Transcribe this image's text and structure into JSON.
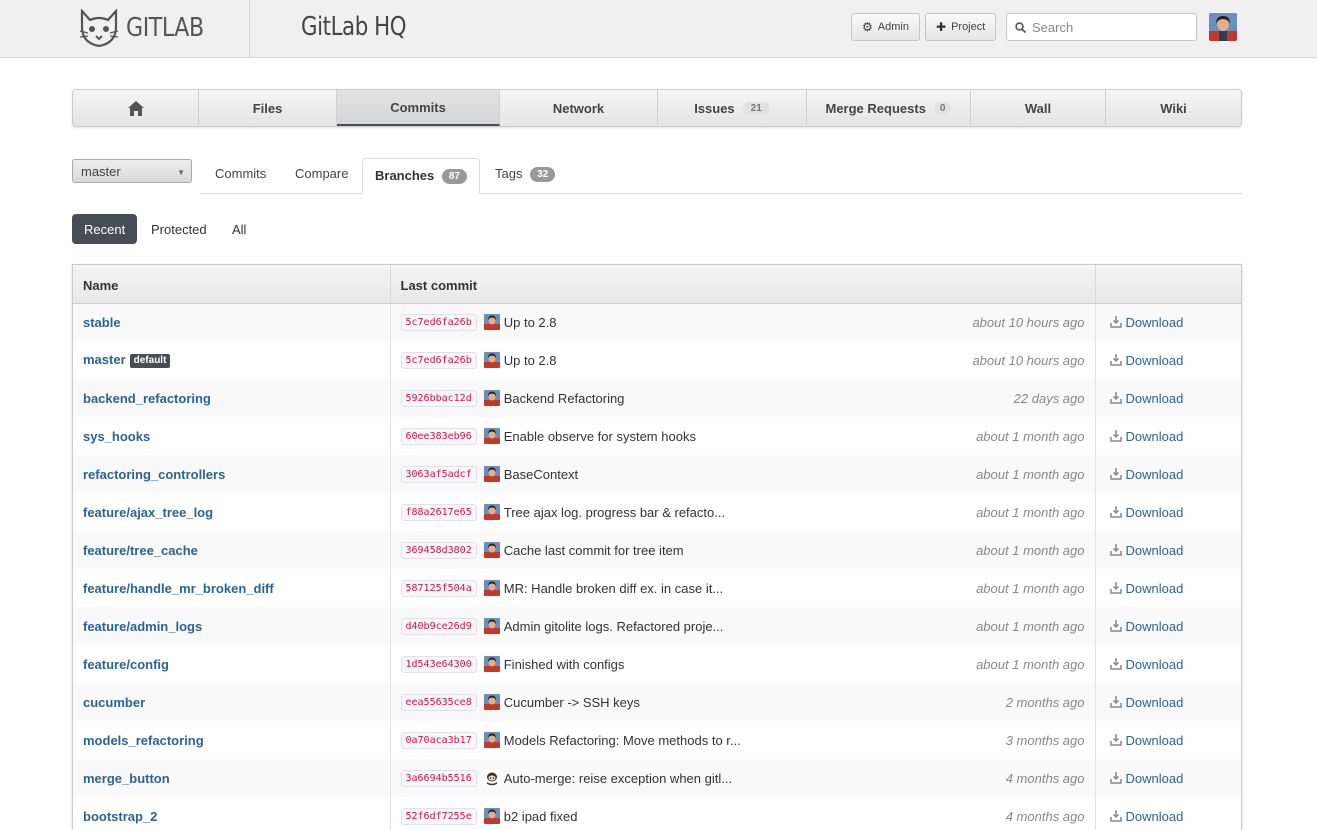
{
  "header": {
    "logo_text": "GITLAB",
    "project_title": "GitLab HQ",
    "admin_label": "Admin",
    "project_label": "Project",
    "search_placeholder": "Search"
  },
  "main_nav": {
    "files": "Files",
    "commits": "Commits",
    "network": "Network",
    "issues": "Issues",
    "issues_count": "21",
    "merge_requests": "Merge Requests",
    "merge_requests_count": "0",
    "wall": "Wall",
    "wiki": "Wiki"
  },
  "branch_select": {
    "value": "master"
  },
  "sub_tabs": {
    "commits": "Commits",
    "compare": "Compare",
    "branches": "Branches",
    "branches_count": "87",
    "tags": "Tags",
    "tags_count": "32"
  },
  "filters": {
    "recent": "Recent",
    "protected": "Protected",
    "all": "All"
  },
  "table": {
    "headers": {
      "name": "Name",
      "last_commit": "Last commit",
      "actions": ""
    },
    "default_badge": "default",
    "download_label": "Download",
    "rows": [
      {
        "name": "stable",
        "default": false,
        "sha": "5c7ed6fa26b",
        "message": "Up to 2.8",
        "time": "about 10 hours ago",
        "avatar": "photo"
      },
      {
        "name": "master",
        "default": true,
        "sha": "5c7ed6fa26b",
        "message": "Up to 2.8",
        "time": "about 10 hours ago",
        "avatar": "photo"
      },
      {
        "name": "backend_refactoring",
        "default": false,
        "sha": "5926bbac12d",
        "message": "Backend Refactoring",
        "time": "22 days ago",
        "avatar": "photo"
      },
      {
        "name": "sys_hooks",
        "default": false,
        "sha": "60ee383eb96",
        "message": "Enable observe for system hooks",
        "time": "about 1 month ago",
        "avatar": "photo"
      },
      {
        "name": "refactoring_controllers",
        "default": false,
        "sha": "3063af5adcf",
        "message": "BaseContext",
        "time": "about 1 month ago",
        "avatar": "photo"
      },
      {
        "name": "feature/ajax_tree_log",
        "default": false,
        "sha": "f88a2617e65",
        "message": "Tree ajax log. progress bar & refacto...",
        "time": "about 1 month ago",
        "avatar": "photo"
      },
      {
        "name": "feature/tree_cache",
        "default": false,
        "sha": "369458d3802",
        "message": "Cache last commit for tree item",
        "time": "about 1 month ago",
        "avatar": "photo"
      },
      {
        "name": "feature/handle_mr_broken_diff",
        "default": false,
        "sha": "587125f504a",
        "message": "MR: Handle broken diff ex. in case it...",
        "time": "about 1 month ago",
        "avatar": "photo"
      },
      {
        "name": "feature/admin_logs",
        "default": false,
        "sha": "d40b9ce26d9",
        "message": "Admin gitolite logs. Refactored proje...",
        "time": "about 1 month ago",
        "avatar": "photo"
      },
      {
        "name": "feature/config",
        "default": false,
        "sha": "1d543e64300",
        "message": "Finished with configs",
        "time": "about 1 month ago",
        "avatar": "photo"
      },
      {
        "name": "cucumber",
        "default": false,
        "sha": "eea55635ce8",
        "message": "Cucumber -> SSH keys",
        "time": "2 months ago",
        "avatar": "photo"
      },
      {
        "name": "models_refactoring",
        "default": false,
        "sha": "0a70aca3b17",
        "message": "Models Refactoring: Move methods to r...",
        "time": "3 months ago",
        "avatar": "photo"
      },
      {
        "name": "merge_button",
        "default": false,
        "sha": "3a6694b5516",
        "message": "Auto-merge: reise exception when gitl...",
        "time": "4 months ago",
        "avatar": "octocat"
      },
      {
        "name": "bootstrap_2",
        "default": false,
        "sha": "52f6df7255e",
        "message": "b2 ipad fixed",
        "time": "4 months ago",
        "avatar": "photo"
      }
    ]
  }
}
